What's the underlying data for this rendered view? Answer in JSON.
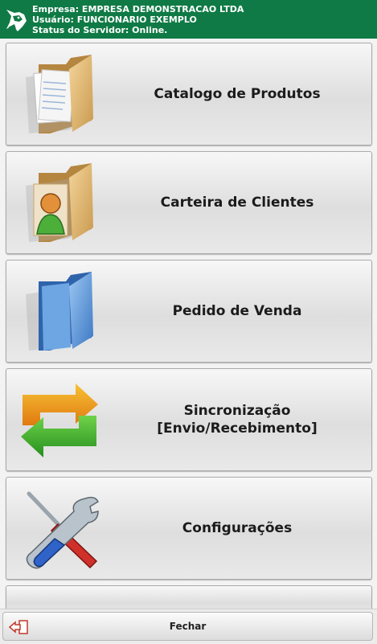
{
  "header": {
    "company_line": "Empresa: EMPRESA DEMONSTRACAO LTDA",
    "user_line": "Usuário: FUNCIONARIO EXEMPLO",
    "server_line": "Status do Servidor: Online.",
    "logo_icon": "wolf-head-logo",
    "background_color": "#0f7a45"
  },
  "menu": {
    "items": [
      {
        "label": "Catalogo de Produtos",
        "icon": "folder-documents-icon"
      },
      {
        "label": "Carteira de Clientes",
        "icon": "folder-user-icon"
      },
      {
        "label": "Pedido de Venda",
        "icon": "blue-folder-icon"
      },
      {
        "label_line1": "Sincronização",
        "label_line2": "[Envio/Recebimento]",
        "icon": "sync-arrows-icon"
      },
      {
        "label": "Configurações",
        "icon": "tools-icon"
      }
    ]
  },
  "footer": {
    "close_label": "Fechar",
    "close_icon": "exit-icon"
  }
}
